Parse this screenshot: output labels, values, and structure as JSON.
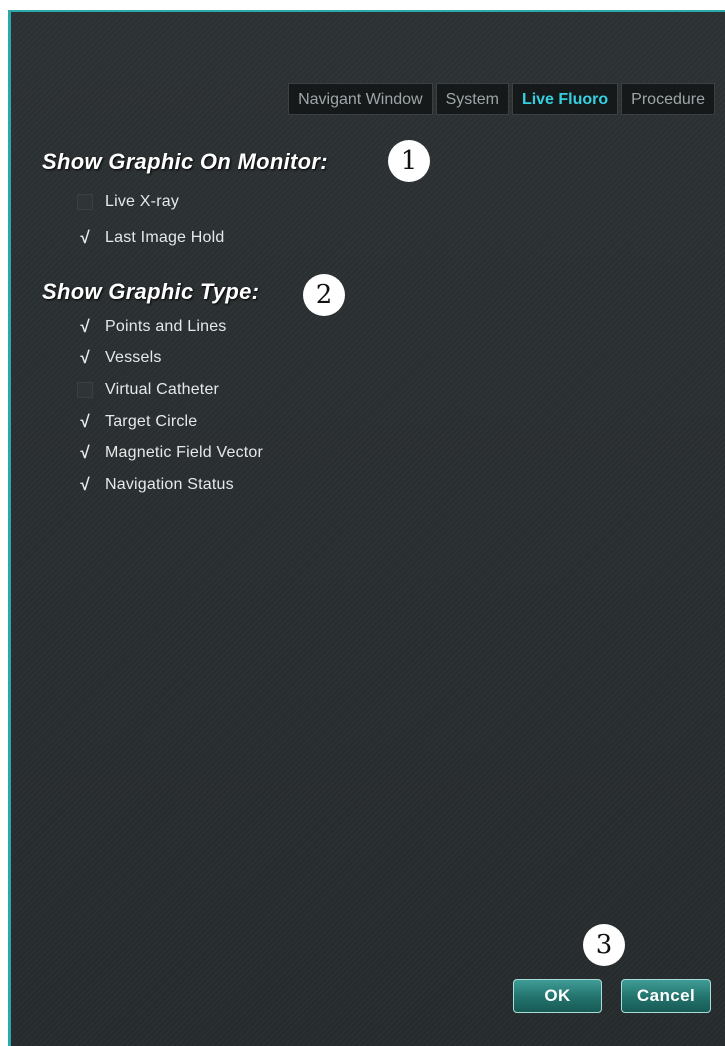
{
  "tabs": [
    {
      "label": "Navigant Window",
      "active": false
    },
    {
      "label": "System",
      "active": false
    },
    {
      "label": "Live Fluoro",
      "active": true
    },
    {
      "label": "Procedure",
      "active": false
    }
  ],
  "monitor_section": {
    "title": "Show Graphic On Monitor:",
    "callout": "1",
    "options": [
      {
        "label": "Live X-ray",
        "checked": false
      },
      {
        "label": "Last Image Hold",
        "checked": true
      }
    ]
  },
  "type_section": {
    "title": "Show Graphic Type:",
    "callout": "2",
    "options": [
      {
        "label": "Points and Lines",
        "checked": true
      },
      {
        "label": "Vessels",
        "checked": true
      },
      {
        "label": "Virtual Catheter",
        "checked": false
      },
      {
        "label": "Target Circle",
        "checked": true
      },
      {
        "label": "Magnetic Field Vector",
        "checked": true
      },
      {
        "label": "Navigation Status",
        "checked": true
      }
    ]
  },
  "buttons_callout": "3",
  "buttons": {
    "ok": "OK",
    "cancel": "Cancel"
  },
  "check_glyph": "√",
  "colors": {
    "accent": "#35d0e0",
    "border": "#2aa9a9",
    "button": "#22726c",
    "background": "#2a2f31"
  }
}
